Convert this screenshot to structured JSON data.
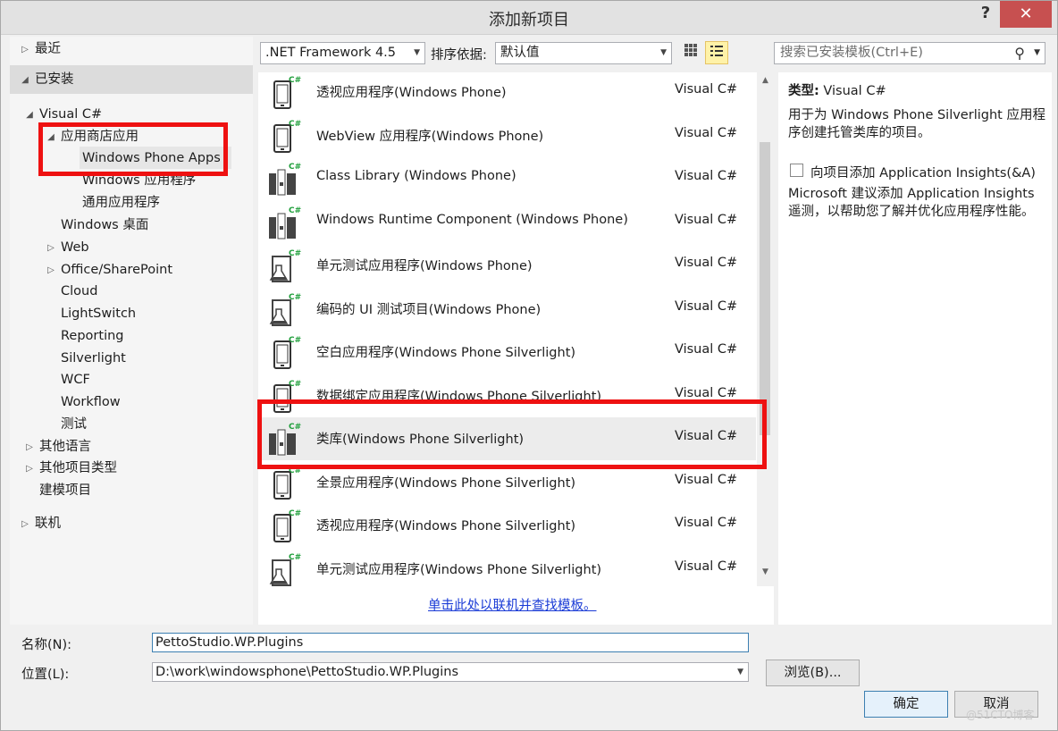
{
  "window": {
    "title": "添加新项目",
    "help_glyph": "?",
    "close_glyph": "✕"
  },
  "nav": {
    "recent": "最近",
    "installed": "已安装",
    "visual_csharp": "Visual C#",
    "store_apps": "应用商店应用",
    "wp_apps": "Windows Phone Apps",
    "windows_apps": "Windows 应用程序",
    "universal_apps": "通用应用程序",
    "desktop": "Windows 桌面",
    "web": "Web",
    "office": "Office/SharePoint",
    "cloud": "Cloud",
    "lightswitch": "LightSwitch",
    "reporting": "Reporting",
    "silverlight": "Silverlight",
    "wcf": "WCF",
    "workflow": "Workflow",
    "test": "测试",
    "other_langs": "其他语言",
    "other_types": "其他项目类型",
    "modeling": "建模项目",
    "online": "联机"
  },
  "toolbar": {
    "framework": ".NET Framework 4.5",
    "sort_label": "排序依据:",
    "sort_value": "默认值",
    "search_placeholder": "搜索已安装模板(Ctrl+E)"
  },
  "templates": [
    {
      "name": "透视应用程序(Windows Phone)",
      "lang": "Visual C#",
      "icon": "phone-pivot-icon"
    },
    {
      "name": "WebView 应用程序(Windows Phone)",
      "lang": "Visual C#",
      "icon": "phone-webview-icon"
    },
    {
      "name": "Class Library (Windows Phone)",
      "lang": "Visual C#",
      "icon": "class-library-icon"
    },
    {
      "name": "Windows Runtime Component (Windows Phone)",
      "lang": "Visual C#",
      "icon": "runtime-component-icon"
    },
    {
      "name": "单元测试应用程序(Windows Phone)",
      "lang": "Visual C#",
      "icon": "unit-test-icon"
    },
    {
      "name": "编码的 UI 测试项目(Windows Phone)",
      "lang": "Visual C#",
      "icon": "coded-ui-test-icon"
    },
    {
      "name": "空白应用程序(Windows Phone Silverlight)",
      "lang": "Visual C#",
      "icon": "phone-blank-icon"
    },
    {
      "name": "数据绑定应用程序(Windows Phone Silverlight)",
      "lang": "Visual C#",
      "icon": "phone-databound-icon"
    },
    {
      "name": "类库(Windows Phone Silverlight)",
      "lang": "Visual C#",
      "icon": "class-library-icon"
    },
    {
      "name": "全景应用程序(Windows Phone Silverlight)",
      "lang": "Visual C#",
      "icon": "phone-panorama-icon"
    },
    {
      "name": "透视应用程序(Windows Phone Silverlight)",
      "lang": "Visual C#",
      "icon": "phone-pivot-icon"
    },
    {
      "name": "单元测试应用程序(Windows Phone Silverlight)",
      "lang": "Visual C#",
      "icon": "unit-test-icon"
    }
  ],
  "online_link": "单击此处以联机并查找模板。",
  "details": {
    "type_label": "类型:",
    "type_value": "Visual C#",
    "description": "用于为 Windows Phone Silverlight 应用程序创建托管类库的项目。",
    "insights_checkbox": "向项目添加 Application Insights(&A)",
    "insights_text": "Microsoft 建议添加 Application Insights 遥测，以帮助您了解并优化应用程序性能。"
  },
  "form": {
    "name_label": "名称(N):",
    "name_value": "PettoStudio.WP.Plugins",
    "location_label": "位置(L):",
    "location_value": "D:\\work\\windowsphone\\PettoStudio.WP.Plugins",
    "browse": "浏览(B)...",
    "ok": "确定",
    "cancel": "取消"
  },
  "watermark": "@51CTO博客",
  "colors": {
    "highlight_red": "#ee1111",
    "accent_green": "#1e9e3a",
    "link_blue": "#1a3bd6"
  }
}
